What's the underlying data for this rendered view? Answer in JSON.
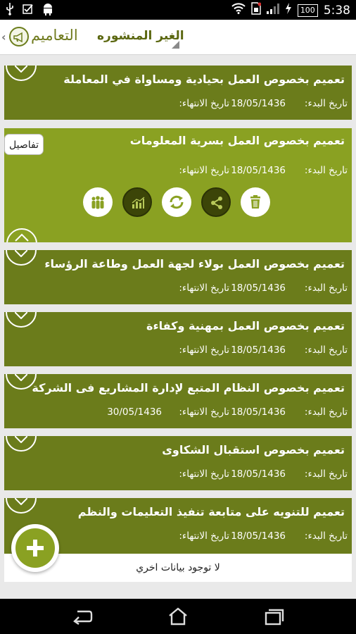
{
  "status_bar": {
    "battery": "100",
    "time": "5:38",
    "icons": [
      "usb-icon",
      "checkbox-icon",
      "android-icon",
      "wifi-icon",
      "sim-icon",
      "signal-icon",
      "charging-icon",
      "battery-icon"
    ]
  },
  "header": {
    "title": "التعاميم",
    "tab": "الغير المنشوره",
    "icons": [
      "chevron-left-icon",
      "megaphone-icon"
    ]
  },
  "labels": {
    "start": "تاريخ البدء:",
    "end": "تاريخ الانتهاء:"
  },
  "details_button": "تفاصيل",
  "circulars": [
    {
      "title": "تعميم بخصوص العمل بحيادية ومساواة في المعاملة",
      "start_date": "18/05/1436",
      "end_date": ""
    },
    {
      "title": "تعميم بخصوص العمل بسرية المعلومات",
      "start_date": "18/05/1436",
      "end_date": ""
    },
    {
      "title": "تعميم بخصوص العمل بولاء لجهة العمل وطاعة الرؤساء",
      "start_date": "18/05/1436",
      "end_date": ""
    },
    {
      "title": "تعميم بخصوص العمل بمهنية وكفاءة",
      "start_date": "18/05/1436",
      "end_date": ""
    },
    {
      "title": "تعميم بخصوص النظام المتبع لإدارة المشاريع فى الشركة",
      "start_date": "18/05/1436",
      "end_date": "30/05/1436"
    },
    {
      "title": "تعميم بخصوص استقبال الشكاوى",
      "start_date": "18/05/1436",
      "end_date": ""
    },
    {
      "title": "تعميم للتنويه على   متابعة تنفيذ التعليمات والنظم",
      "start_date": "18/05/1436",
      "end_date": ""
    }
  ],
  "card_actions": [
    "users-icon",
    "stats-icon",
    "refresh-icon",
    "share-icon",
    "trash-icon"
  ],
  "no_more": "لا توجود بيانات اخري",
  "fab_icon": "plus-icon",
  "nav": [
    "back-icon",
    "home-icon",
    "recent-apps-icon"
  ],
  "colors": {
    "card_dark": "#6b7c1b",
    "card_selected": "#8aa122",
    "header_title": "#707b1f"
  }
}
